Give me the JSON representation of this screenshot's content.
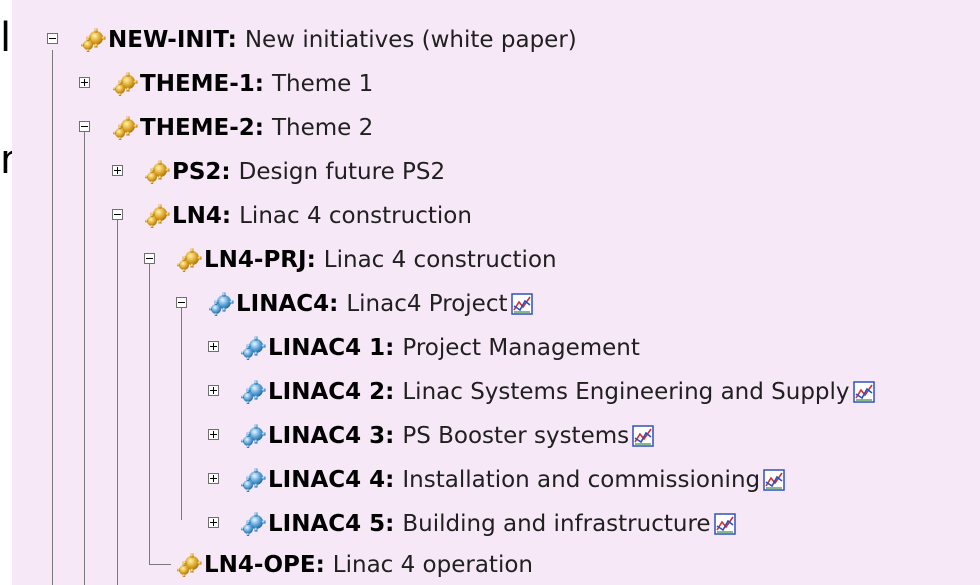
{
  "edge_text": {
    "line1": "l",
    "line2": "n"
  },
  "colors": {
    "panel_bg": "#f7e8f7",
    "gear_gold": "#d9a520",
    "gear_blue": "#4a90c8",
    "tree_line": "#7a7a7a"
  },
  "tree": [
    {
      "code": "NEW-INIT:",
      "desc": "New initiatives (white paper)",
      "icon": "gear-gold-icon",
      "expanded": true,
      "chart": false
    },
    {
      "code": "THEME-1:",
      "desc": "Theme 1",
      "icon": "gear-gold-icon",
      "expanded": false,
      "chart": false
    },
    {
      "code": "THEME-2:",
      "desc": "Theme 2",
      "icon": "gear-gold-icon",
      "expanded": true,
      "chart": false
    },
    {
      "code": "PS2:",
      "desc": "Design future PS2",
      "icon": "gear-gold-icon",
      "expanded": false,
      "chart": false
    },
    {
      "code": "LN4:",
      "desc": "Linac 4 construction",
      "icon": "gear-gold-icon",
      "expanded": true,
      "chart": false
    },
    {
      "code": "LN4-PRJ:",
      "desc": "Linac 4 construction",
      "icon": "gear-gold-icon",
      "expanded": true,
      "chart": false
    },
    {
      "code": "LINAC4:",
      "desc": "Linac4 Project",
      "icon": "gear-blue-icon",
      "expanded": true,
      "chart": true
    },
    {
      "code": "LINAC4 1:",
      "desc": "Project Management",
      "icon": "gear-blue-icon",
      "expanded": false,
      "chart": false
    },
    {
      "code": "LINAC4 2:",
      "desc": "Linac Systems Engineering and Supply",
      "icon": "gear-blue-icon",
      "expanded": false,
      "chart": true
    },
    {
      "code": "LINAC4 3:",
      "desc": "PS Booster systems",
      "icon": "gear-blue-icon",
      "expanded": false,
      "chart": true
    },
    {
      "code": "LINAC4 4:",
      "desc": "Installation and commissioning",
      "icon": "gear-blue-icon",
      "expanded": false,
      "chart": true
    },
    {
      "code": "LINAC4 5:",
      "desc": "Building and infrastructure",
      "icon": "gear-blue-icon",
      "expanded": false,
      "chart": true
    },
    {
      "code": "LN4-OPE:",
      "desc": "Linac 4 operation",
      "icon": "gear-gold-icon",
      "expanded": null,
      "chart": false
    }
  ]
}
